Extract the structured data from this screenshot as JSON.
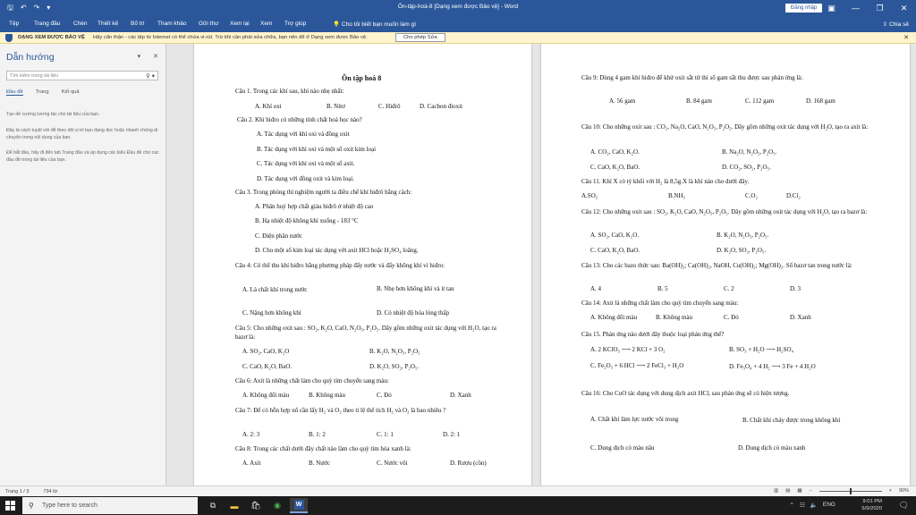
{
  "window": {
    "title": "Ôn-tập-hoá-8 [Dạng xem được Bảo vệ] - Word",
    "signin": "Đăng nhập",
    "qat_icons": [
      "save-icon",
      "undo-icon",
      "redo-icon",
      "customize-icon"
    ]
  },
  "ribbon": {
    "tabs": [
      "Tệp",
      "Trang đầu",
      "Chèn",
      "Thiết kế",
      "Bố trí",
      "Tham khảo",
      "Gửi thư",
      "Xem lại",
      "Xem",
      "Trợ giúp"
    ],
    "tell_me": "Cho tôi biết bạn muốn làm gì",
    "share": "Chia sẻ"
  },
  "protected_view": {
    "label": "DẠNG XEM ĐƯỢC BẢO VỆ",
    "message": "Hãy cẩn thận - các tệp từ Internet có thể chứa vi-rút. Trừ khi cần phải sửa chữa, bạn nên để ở Dạng xem được Bảo vệ.",
    "enable_button": "Cho phép Sửa"
  },
  "nav_pane": {
    "title": "Dẫn hướng",
    "search_placeholder": "Tìm kiếm trong tài liệu",
    "tabs": [
      "Đầu đề",
      "Trang",
      "Kết quả"
    ],
    "help1": "Tạo dề cương tương tác cho tài liệu của bạn.",
    "help2": "Đây là cách tuyệt vời để theo dõi vị trí bạn đang đọc hoặc nhanh chóng di chuyển trong nội dung của bạn.",
    "help3": "Để bắt đầu, hãy đi đến tab Trang đầu và áp dụng các kiểu Đầu đề cho các đầu đề trong tài liệu của bạn."
  },
  "page1": {
    "title": "Ôn tập hoá 8",
    "q1": "Câu 1. Trong các khí sau, khí nào nhẹ nhất:",
    "q1_a": "A. Khí oxi",
    "q1_b": "B. Nitơ",
    "q1_c": "C. Hiđrô",
    "q1_d": "D. Cacbon đioxit",
    "q2": "Câu 2. Khí hiđro có những tính chất hoá học nào?",
    "q2_a": "A. Tác dụng với khí oxi và đồng oxit",
    "q2_b": "B. Tác dụng với khí oxi và một số oxit kim loại",
    "q2_c": "C. Tác dụng với khí oxi và một số axit.",
    "q2_d": "D. Tác dụng với đồng oxit và kim loại.",
    "q3": "Câu 3. Trong phòng thí nghiệm người ta điều chế khí hiđrô bằng cách:",
    "q3_a": "A. Phân huỷ hợp chất giàu hiđrô ở nhiệt độ cao",
    "q3_b": "B. Hạ nhiệt độ không khí xuống - 183 °C",
    "q3_c": "C. Điện phân nước",
    "q3_d": "D. Cho một số kim loại tác dụng với axit HCl hoặc H₂SO₄ loãng.",
    "q4": "Câu 4: Có thể thu khí hiđro bằng phương pháp đẩy nước và đẩy không khí vì hiđro:",
    "q4_a": "A. Là chất khí trong nước",
    "q4_b": "B. Nhẹ hơn không khí và ít tan",
    "q4_c": "C. Nặng hơn không khí",
    "q4_d": "D. Có nhiệt độ hóa lỏng thấp",
    "q5": "Câu 5: Cho những oxit sau : SO₂, K₂O, CaO, N₂O₅, P₂O₅. Dãy gồm những oxit tác dụng với H₂O, tạo ra bazơ là:",
    "q5_a": "A. SO₂, CaO, K₂O",
    "q5_b": "B. K₂O, N₂O₅, P₂O₅",
    "q5_c": "C. CaO, K₂O, BaO.",
    "q5_d": "D. K₂O, SO₂, P₂O₅.",
    "q6": "Câu 6: Axit là những chất làm cho quỳ tím chuyển sang màu:",
    "q6_a": "A. Không đổi màu",
    "q6_b": "B. Không màu",
    "q6_c": "C. Đỏ",
    "q6_d": "D. Xanh",
    "q7": "Câu 7: Để có hỗn hợp nổ cần lấy H₂ và O₂ theo tỉ lệ thể tích H₂ và O₂ là bao nhiêu ?",
    "q7_a": "A. 2: 3",
    "q7_b": "B. 1: 2",
    "q7_c": "C. 1: 1",
    "q7_d": "D. 2: 1",
    "q8": "Câu 8: Trong các chất dưới đây chất nào làm cho quỳ tím hóa xanh là:",
    "q8_a": "A. Axit",
    "q8_b": "B. Nước",
    "q8_c": "C. Nước vôi",
    "q8_d": "D. Rượu (cồn)"
  },
  "page2": {
    "q9": "Câu 9: Dùng 4 gam khí hiđro để khử oxit sắt từ thì số gam sắt thu được sau phản ứng là:",
    "q9_a": "A. 56 gam",
    "q9_b": "B. 84 gam",
    "q9_c": "C. 112 gam",
    "q9_d": "D. 168 gam",
    "q10": "Câu 10: Cho những oxit sau : CO₂, Na₂O, CaO, N₂O₅, P₂O₅. Dãy gồm những oxit tác dụng với H₂O, tạo ra axit là:",
    "q10_a": "A. CO₂, CaO, K₂O.",
    "q10_b": "B. Na₂O, N₂O₅, P₂O₅.",
    "q10_c": "C. CaO, K₂O, BaO.",
    "q10_d": "D. CO₂, SO₂, P₂O₅.",
    "q11": "Câu 11. Khí X có tỷ khối với H₂ là 8,5g.X là khí nào cho dưới đây.",
    "q11_a": "A.SO₂",
    "q11_b": "B.NH₃",
    "q11_c": "C.O₂",
    "q11_d": "D.Cl₂",
    "q12": "Câu 12: Cho những oxit sau : SO₂, K₂O, CaO, N₂O₅, P₂O₅. Dãy gồm những oxit tác dụng    với H₂O, tạo ra bazơ là:",
    "q12_a": "A. SO₂, CaO, K₂O.",
    "q12_b": "B. K₂O, N₂O₅, P₂O₅.",
    "q12_c": "C. CaO, K₂O, BaO.",
    "q12_d": "D. K₂O, SO₂, P₂O₅.",
    "q13": "Câu 13: Cho các bazo thức sau: Ba(OH)₂; Ca(OH)₂, NaOH, Cu(OH)₂; Mg(OH)₂. Số bazơ tan trong nước là:",
    "q13_a": "A. 4",
    "q13_b": "B. 5",
    "q13_c": "C. 2",
    "q13_d": "D. 3",
    "q14": "Câu 14: Axit là những chất làm cho quỳ tím chuyển sang màu:",
    "q14_a": "A. Không đổi màu",
    "q14_b": "B. Không màu",
    "q14_c": "C. Đỏ",
    "q14_d": "D. Xanh",
    "q15": "Câu 15. Phản ứng nào dưới đây thuộc loại phản ứng thế?",
    "q15_a": "A. 2 KClO₃ ⟶ 2 KCl + 3 O₂",
    "q15_b": "B. SO₃ + H₂O ⟶ H₂SO₄",
    "q15_c": "C. Fe₂O₃ + 6 HCl ⟶ 2 FeCl₃ + H₂O",
    "q15_d": "D. Fe₃O₄ + 4 H₂ ⟶ 3 Fe + 4 H₂O",
    "q16": "Câu 16: Cho CuO tác dụng với dung dịch axit HCl, sau phản ứng sẽ có hiện tượng.",
    "q16_a": "A. Chất khí làm lực nước vôi trong",
    "q16_b": "B. Chất khí cháy được trong không khí",
    "q16_c": "C. Dung dịch có màu nâu",
    "q16_d": "D. Dung dịch có màu xanh"
  },
  "status": {
    "page": "Trang 1 / 3",
    "words": "734 từ",
    "zoom": "90%"
  },
  "taskbar": {
    "search_placeholder": "Type here to search",
    "time": "9:01 PM",
    "date": "5/9/2020"
  }
}
